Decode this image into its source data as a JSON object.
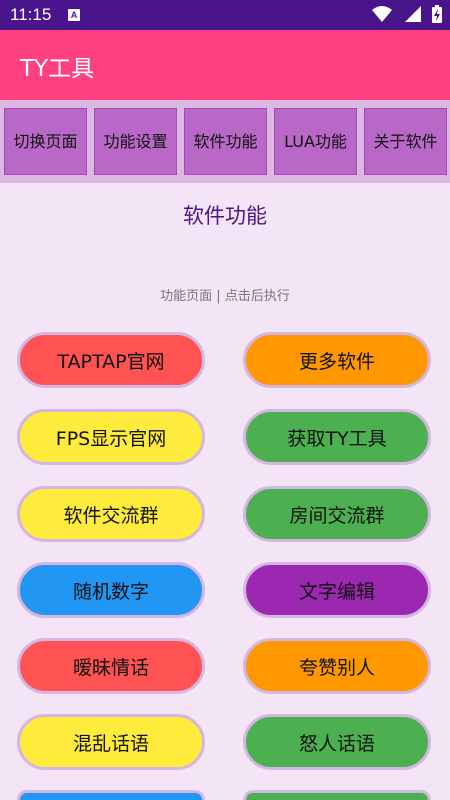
{
  "status_bar": {
    "time": "11:15",
    "notification_glyph": "A",
    "icons": [
      "wifi-icon",
      "signal-icon",
      "battery-charging-icon"
    ]
  },
  "app_bar": {
    "title": "TY工具"
  },
  "nav_tabs": [
    {
      "label": "切换页面"
    },
    {
      "label": "功能设置"
    },
    {
      "label": "软件功能"
    },
    {
      "label": "LUA功能"
    },
    {
      "label": "关于软件"
    }
  ],
  "page": {
    "heading": "软件功能",
    "subtitle": "功能页面 | 点击后执行"
  },
  "buttons": [
    {
      "label": "TAPTAP官网",
      "color": "#ff5252"
    },
    {
      "label": "更多软件",
      "color": "#ff9800"
    },
    {
      "label": "FPS显示官网",
      "color": "#ffeb3b"
    },
    {
      "label": "获取TY工具",
      "color": "#4caf50"
    },
    {
      "label": "软件交流群",
      "color": "#ffeb3b"
    },
    {
      "label": "房间交流群",
      "color": "#4caf50"
    },
    {
      "label": "随机数字",
      "color": "#2196f3"
    },
    {
      "label": "文字编辑",
      "color": "#9c27b0"
    },
    {
      "label": "暧昧情话",
      "color": "#ff5252"
    },
    {
      "label": "夸赞别人",
      "color": "#ff9800"
    },
    {
      "label": "混乱话语",
      "color": "#ffeb3b"
    },
    {
      "label": "怒人话语",
      "color": "#4caf50"
    },
    {
      "label": "",
      "color": "#2196f3"
    },
    {
      "label": "",
      "color": "#4caf50"
    }
  ],
  "colors": {
    "status_bar": "#4a148c",
    "app_bar": "#ff4081",
    "nav_row": "#dcb9e0",
    "nav_tab": "#ba68c8",
    "background": "#f3e5f5",
    "heading": "#4a148c"
  }
}
